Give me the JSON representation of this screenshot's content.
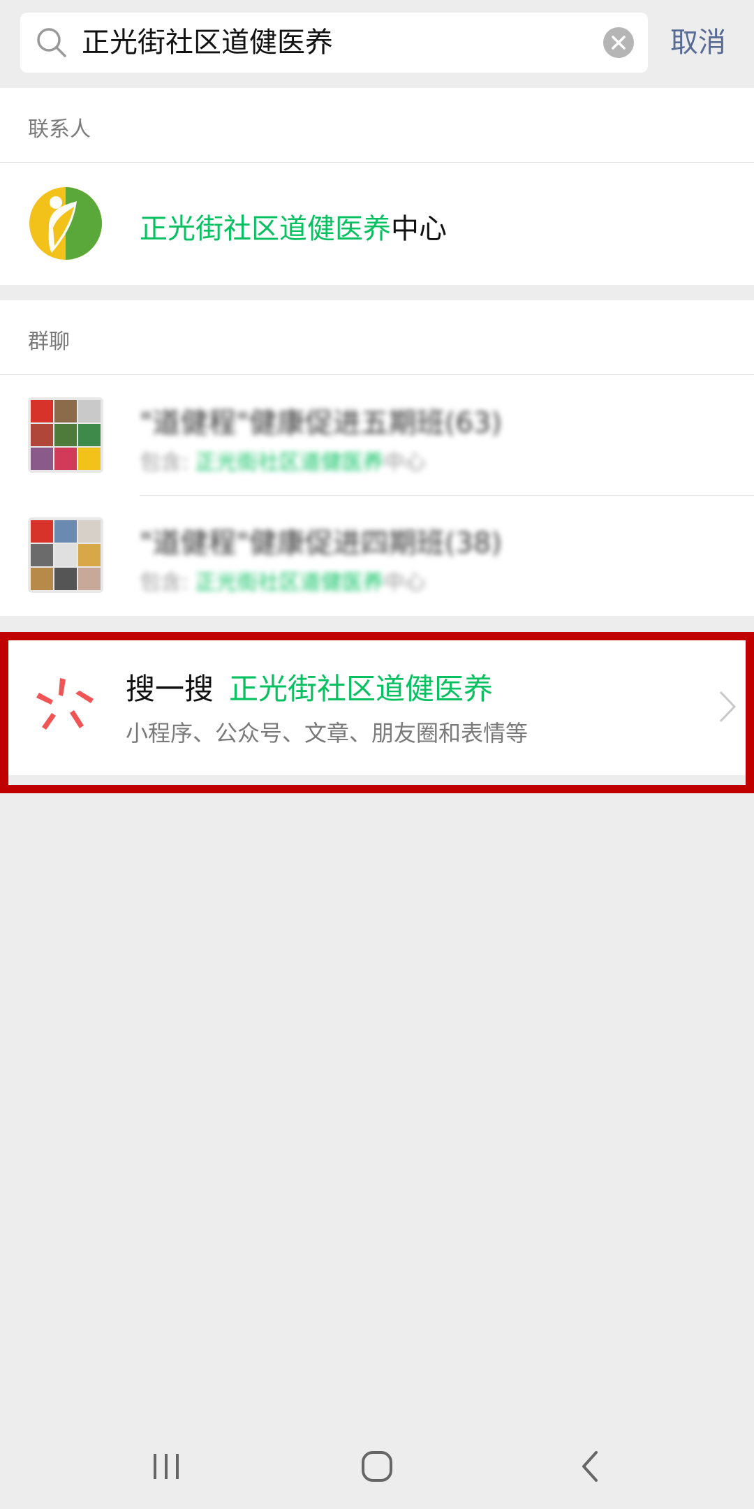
{
  "search": {
    "query": "正光街社区道健医养",
    "cancel_label": "取消"
  },
  "contacts": {
    "header": "联系人",
    "items": [
      {
        "highlight": "正光街社区道健医养",
        "rest": "中心",
        "avatar": "green-yellow-leaf-logo"
      }
    ]
  },
  "groups": {
    "header": "群聊",
    "items": [
      {
        "title": "\"道健程\"健康促进五期班(63)",
        "sub_prefix": "包含: ",
        "sub_highlight": "正光街社区道健医养",
        "sub_rest": "中心"
      },
      {
        "title": "\"道健程\"健康促进四期班(38)",
        "sub_prefix": "包含: ",
        "sub_highlight": "正光街社区道健医养",
        "sub_rest": "中心"
      }
    ]
  },
  "sys_search": {
    "label": "搜一搜",
    "keyword": "正光街社区道健医养",
    "subtitle": "小程序、公众号、文章、朋友圈和表情等"
  },
  "colors": {
    "highlight": "#07c160",
    "cancel": "#576b95",
    "frame": "#c00000"
  }
}
